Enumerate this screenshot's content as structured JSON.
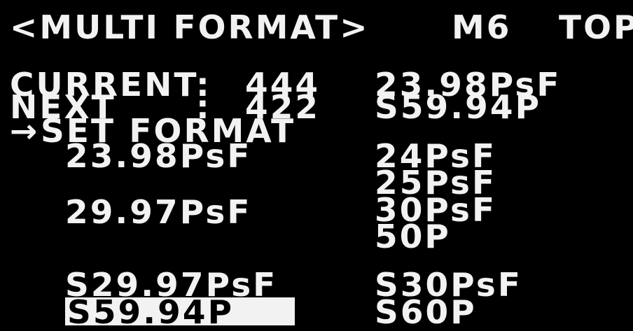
{
  "header": {
    "title": "<MULTI FORMAT>",
    "mode": "M6",
    "page": "TOP"
  },
  "status": {
    "current_label": "CURRENT",
    "current_sep": ":",
    "current_value": "444",
    "current_format": "23.98PsF",
    "next_label": "NEXT",
    "next_sep": ":",
    "next_value": "422",
    "next_format": "S59.94P"
  },
  "menu": {
    "cursor": "→",
    "set_format_label": "SET FORMAT"
  },
  "formats": {
    "left": {
      "item1": "23.98PsF",
      "item2": "29.97PsF",
      "item3": "S29.97PsF",
      "item4_selected": "S59.94P"
    },
    "right": {
      "item1": "24PsF",
      "item2": "25PsF",
      "item3": "30PsF",
      "item4": "50P",
      "item5": "S30PsF",
      "item6": "S60P"
    }
  },
  "colors": {
    "background": "#000000",
    "text": "#f2f2f2",
    "selection_background": "#f2f2f2",
    "selection_text": "#000000"
  }
}
